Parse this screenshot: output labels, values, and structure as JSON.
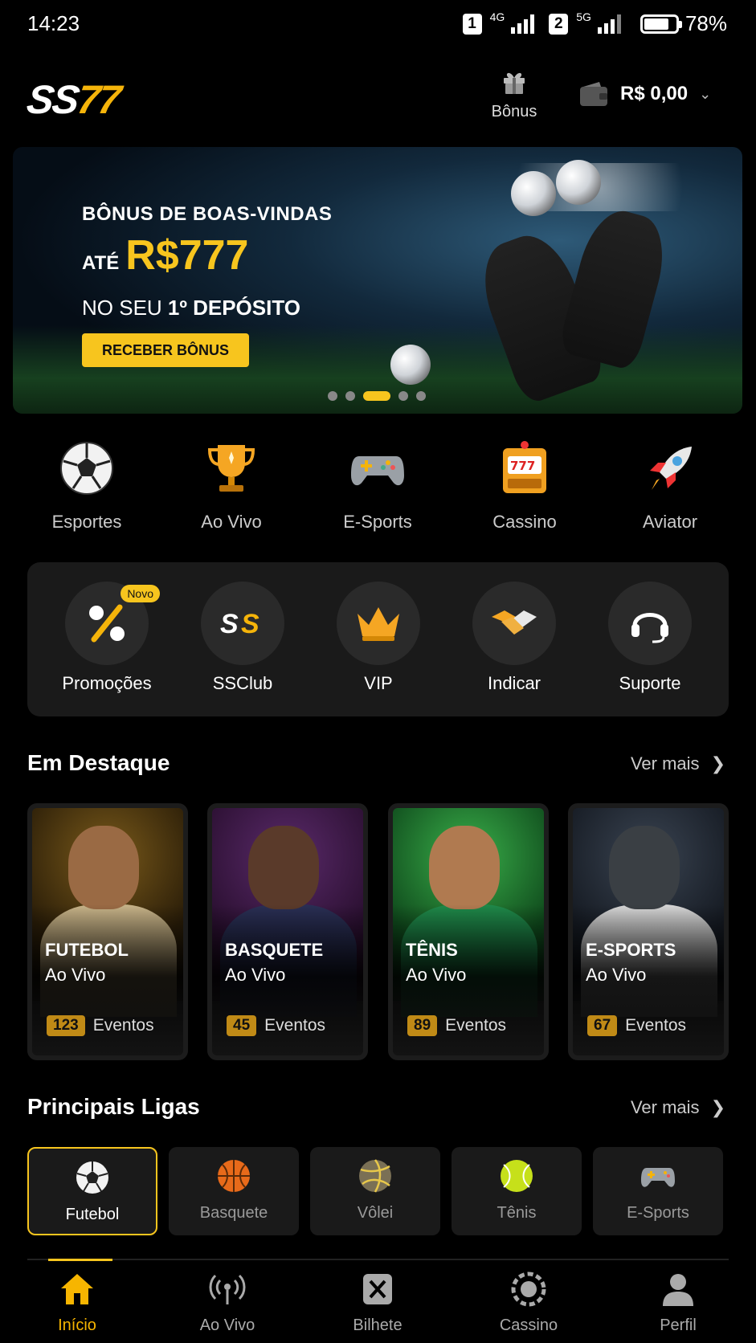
{
  "status": {
    "time": "14:23",
    "sim1": "1",
    "net1": "4G",
    "sim2": "2",
    "net2": "5G",
    "battery": "78%"
  },
  "header": {
    "logo_part1": "SS",
    "logo_part2": "77",
    "bonus_label": "Bônus",
    "balance": "R$ 0,00"
  },
  "banner": {
    "line1": "BÔNUS DE BOAS-VINDAS",
    "ate": "ATÉ",
    "amount": "R$777",
    "line3_prefix": "NO SEU",
    "line3_bold": "1º DEPÓSITO",
    "cta": "RECEBER BÔNUS",
    "slides": 5,
    "active_slide": 3
  },
  "categories": [
    {
      "label": "Esportes",
      "icon": "soccer-ball-icon"
    },
    {
      "label": "Ao Vivo",
      "icon": "trophy-icon"
    },
    {
      "label": "E-Sports",
      "icon": "gamepad-icon"
    },
    {
      "label": "Cassino",
      "icon": "slot-machine-icon"
    },
    {
      "label": "Aviator",
      "icon": "rocket-icon"
    }
  ],
  "quick": [
    {
      "label": "Promoções",
      "icon": "percent-icon",
      "badge": "Novo"
    },
    {
      "label": "SSClub",
      "icon": "ss-logo-icon"
    },
    {
      "label": "VIP",
      "icon": "crown-icon"
    },
    {
      "label": "Indicar",
      "icon": "handshake-icon"
    },
    {
      "label": "Suporte",
      "icon": "headset-icon"
    }
  ],
  "featured": {
    "title": "Em Destaque",
    "more": "Ver mais",
    "cards": [
      {
        "sport": "FUTEBOL",
        "status": "Ao Vivo",
        "count": "123",
        "events": "Eventos"
      },
      {
        "sport": "BASQUETE",
        "status": "Ao Vivo",
        "count": "45",
        "events": "Eventos"
      },
      {
        "sport": "TÊNIS",
        "status": "Ao Vivo",
        "count": "89",
        "events": "Eventos"
      },
      {
        "sport": "E-SPORTS",
        "status": "Ao Vivo",
        "count": "67",
        "events": "Eventos"
      }
    ]
  },
  "leagues": {
    "title": "Principais Ligas",
    "more": "Ver mais",
    "items": [
      {
        "label": "Futebol",
        "icon": "soccer-ball-icon",
        "active": true
      },
      {
        "label": "Basquete",
        "icon": "basketball-icon"
      },
      {
        "label": "Vôlei",
        "icon": "volleyball-icon"
      },
      {
        "label": "Tênis",
        "icon": "tennis-ball-icon"
      },
      {
        "label": "E-Sports",
        "icon": "gamepad-icon"
      }
    ]
  },
  "nav": [
    {
      "label": "Início",
      "icon": "home-icon",
      "active": true
    },
    {
      "label": "Ao Vivo",
      "icon": "live-broadcast-icon"
    },
    {
      "label": "Bilhete",
      "icon": "ticket-icon"
    },
    {
      "label": "Cassino",
      "icon": "casino-chip-icon"
    },
    {
      "label": "Perfil",
      "icon": "user-icon"
    }
  ],
  "colors": {
    "accent": "#f7c51e",
    "background": "#000000",
    "panel": "#1a1a1a"
  }
}
